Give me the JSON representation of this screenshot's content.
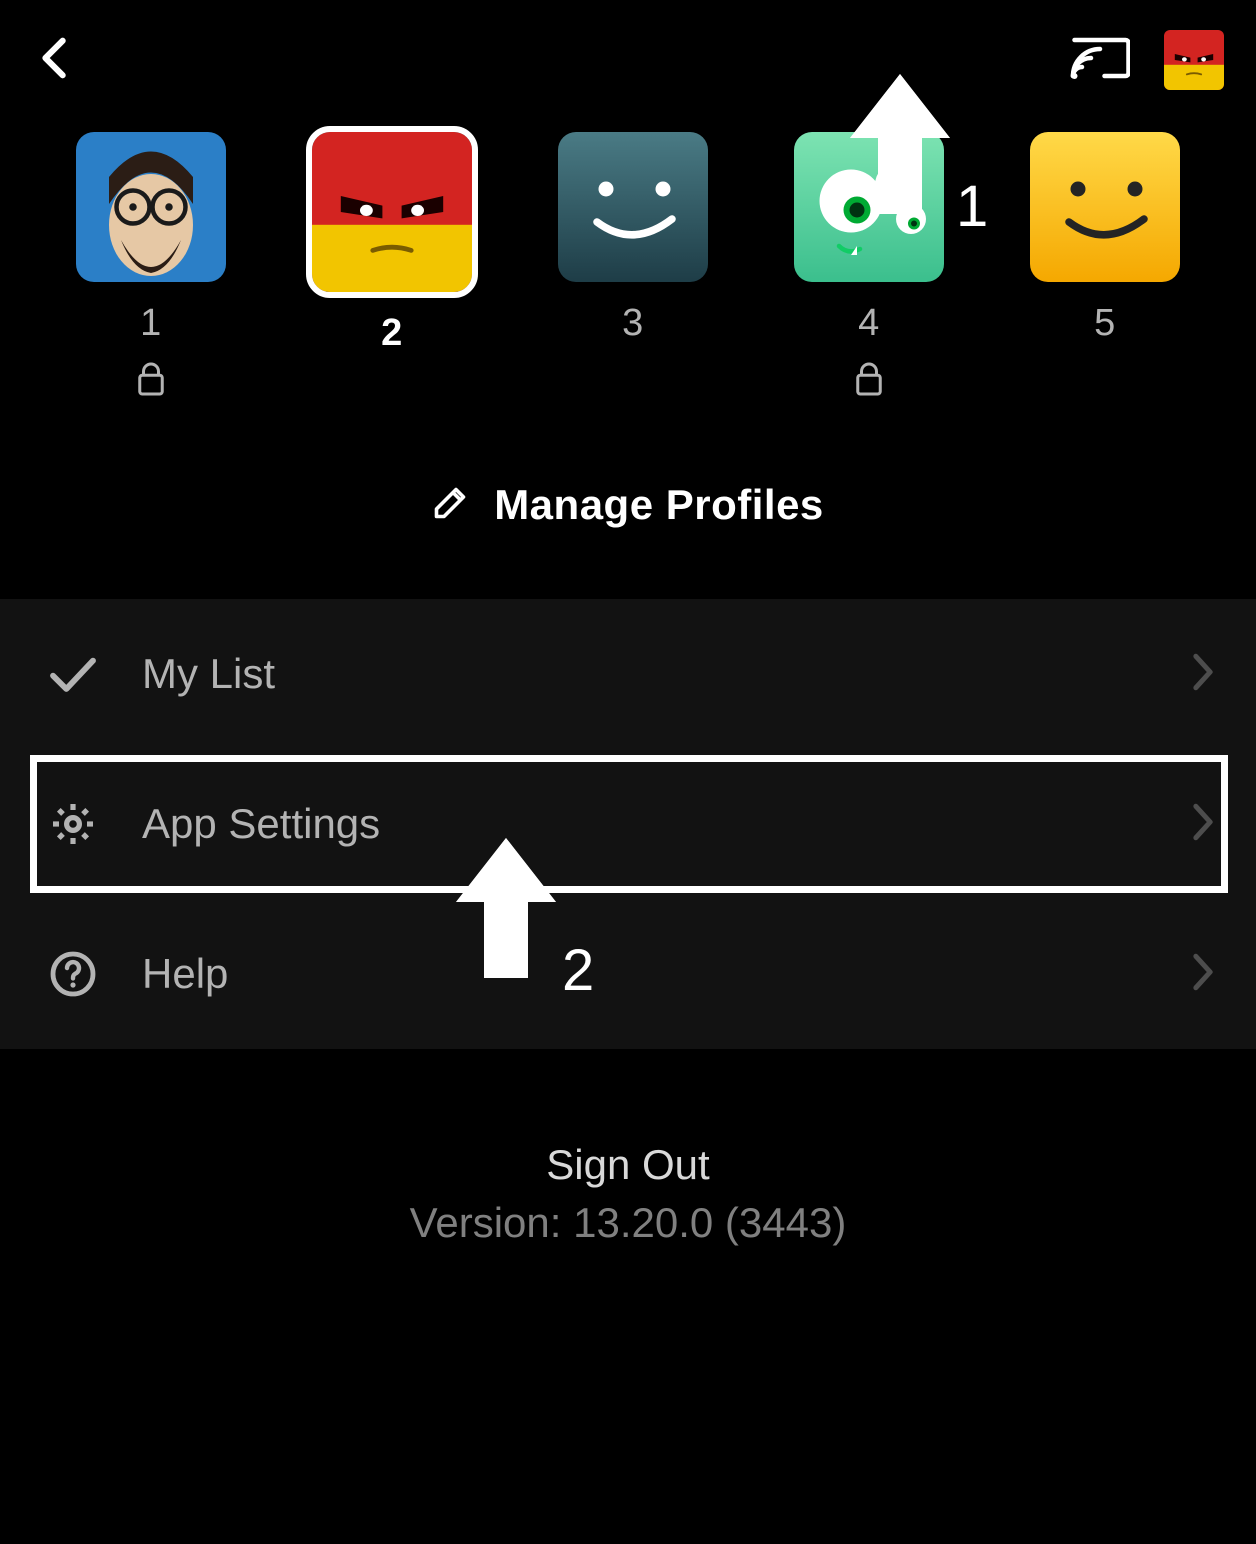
{
  "header": {
    "current_profile_index": 1
  },
  "profiles": [
    {
      "name": "1",
      "locked": true,
      "selected": false,
      "avatar": "man"
    },
    {
      "name": "2",
      "locked": false,
      "selected": true,
      "avatar": "red"
    },
    {
      "name": "3",
      "locked": false,
      "selected": false,
      "avatar": "teal"
    },
    {
      "name": "4",
      "locked": true,
      "selected": false,
      "avatar": "green"
    },
    {
      "name": "5",
      "locked": false,
      "selected": false,
      "avatar": "yellow"
    }
  ],
  "manage_label": "Manage Profiles",
  "menu": [
    {
      "icon": "check",
      "label": "My List"
    },
    {
      "icon": "gear",
      "label": "App Settings"
    },
    {
      "icon": "help",
      "label": "Help"
    }
  ],
  "footer": {
    "signout": "Sign Out",
    "version": "Version: 13.20.0 (3443)"
  },
  "annotations": {
    "arrow1": "1",
    "arrow2": "2"
  }
}
